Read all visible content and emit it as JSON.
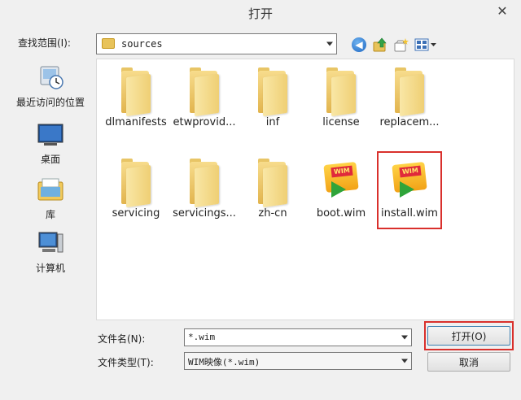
{
  "window": {
    "title": "打开",
    "close_glyph": "✕"
  },
  "lookin": {
    "label": "查找范围(I):",
    "value": "sources"
  },
  "toolbar": {
    "back_icon": "back-arrow-icon",
    "up_icon": "up-folder-icon",
    "new_folder_icon": "new-folder-icon",
    "view_icon": "view-menu-icon"
  },
  "sidebar": {
    "items": [
      {
        "label": "最近访问的位置",
        "icon": "recent-places-icon"
      },
      {
        "label": "桌面",
        "icon": "desktop-icon"
      },
      {
        "label": "库",
        "icon": "libraries-icon"
      },
      {
        "label": "计算机",
        "icon": "computer-icon"
      }
    ]
  },
  "files": [
    {
      "name": "dlmanifests",
      "type": "folder"
    },
    {
      "name": "etwprovid...",
      "type": "folder"
    },
    {
      "name": "inf",
      "type": "folder"
    },
    {
      "name": "license",
      "type": "folder"
    },
    {
      "name": "replacem...",
      "type": "folder"
    },
    {
      "name": "servicing",
      "type": "folder"
    },
    {
      "name": "servicings...",
      "type": "folder"
    },
    {
      "name": "zh-cn",
      "type": "folder"
    },
    {
      "name": "boot.wim",
      "type": "wim"
    },
    {
      "name": "install.wim",
      "type": "wim"
    }
  ],
  "wim_badge": "WIM",
  "filename": {
    "label": "文件名(N):",
    "value": "*.wim"
  },
  "filetype": {
    "label": "文件类型(T):",
    "value": "WIM映像(*.wim)"
  },
  "buttons": {
    "open": "打开(O)",
    "cancel": "取消"
  },
  "colors": {
    "highlight": "#d9302c",
    "folder": "#e8c35a",
    "accent": "#1d66c2"
  }
}
